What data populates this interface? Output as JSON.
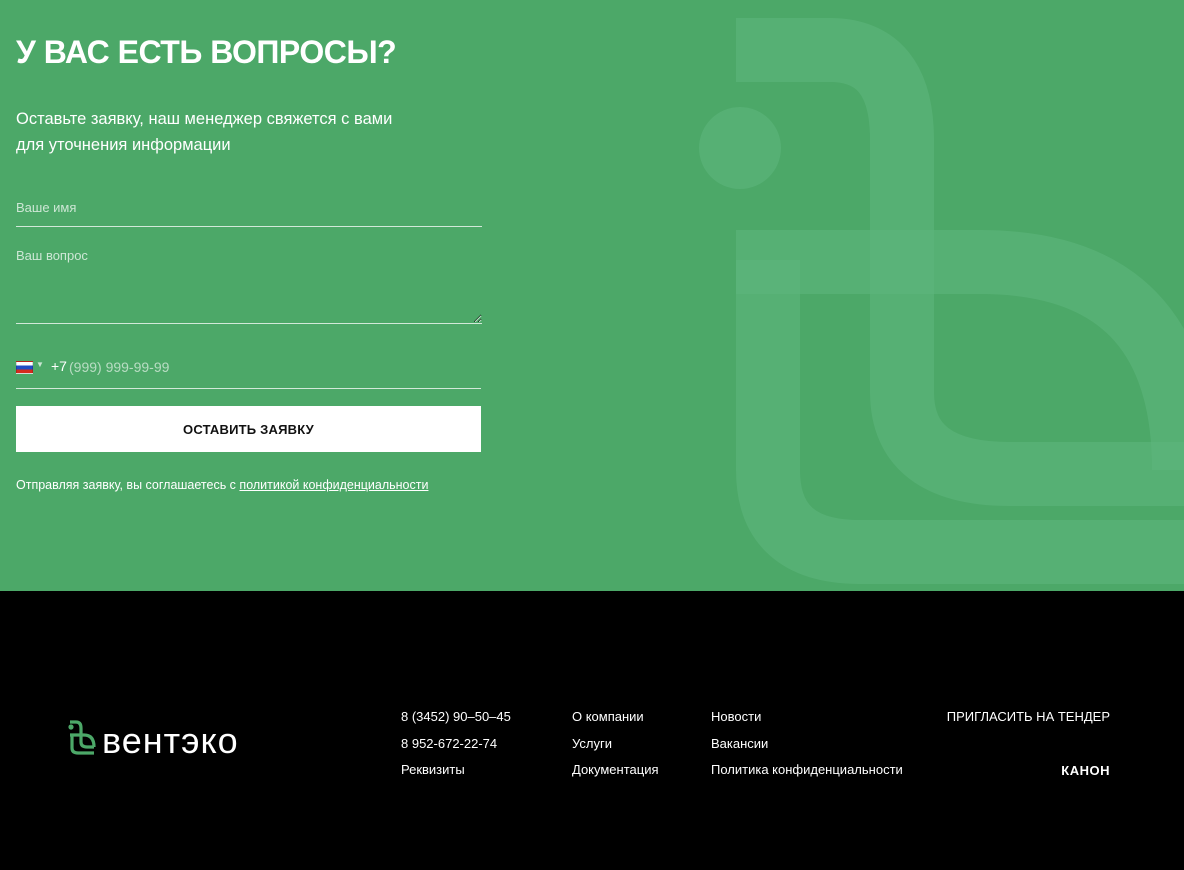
{
  "hero": {
    "title": "У ВАС ЕСТЬ ВОПРОСЫ?",
    "subtitle_line1": "Оставьте заявку, наш менеджер свяжется с вами",
    "subtitle_line2": "для уточнения информации"
  },
  "form": {
    "name_placeholder": "Ваше имя",
    "question_placeholder": "Ваш вопрос",
    "phone_code": "+7",
    "phone_placeholder": "(999) 999-99-99",
    "submit_label": "ОСТАВИТЬ ЗАЯВКУ",
    "consent_text": "Отправляя заявку, вы соглашаетесь с ",
    "consent_link": "политикой конфиденциальности"
  },
  "footer": {
    "logo_text": "вентэко",
    "contacts": {
      "phone1": "8 (3452) 90–50–45",
      "phone2": "8 952-672-22-74",
      "requisites": "Реквизиты"
    },
    "nav_col1": [
      "О компании",
      "Услуги",
      "Документация"
    ],
    "nav_col2": [
      "Новости",
      "Вакансии",
      "Политика конфиденциальности"
    ],
    "tender_label": "ПРИГЛАСИТЬ НА ТЕНДЕР",
    "developer_label": "КАНОН"
  },
  "colors": {
    "hero_bg": "#4ca868",
    "brand_green": "#4ca868",
    "footer_bg": "#000000"
  }
}
